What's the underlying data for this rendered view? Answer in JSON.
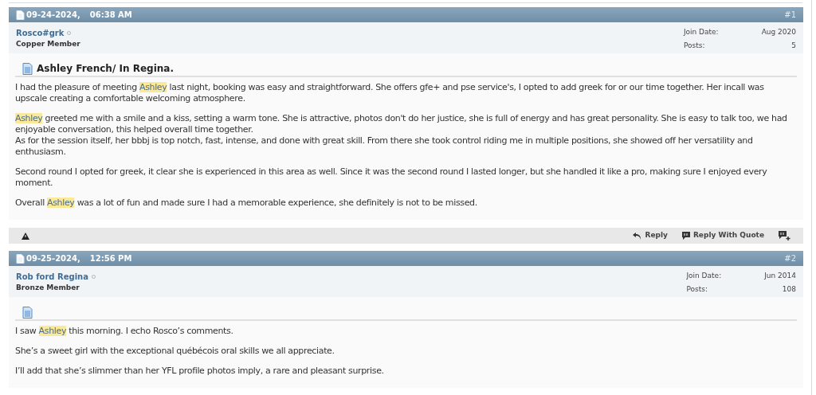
{
  "posts": [
    {
      "date": "09-24-2024,",
      "time": "06:38 AM",
      "number": "#1",
      "user": {
        "name": "Rosco#grk",
        "online": false,
        "rank": "Copper Member"
      },
      "stats": [
        {
          "label": "Join Date:",
          "value": "Aug 2020"
        },
        {
          "label": "Posts:",
          "value": "5"
        }
      ],
      "title": "Ashley French/ In Regina.",
      "paragraphs": [
        {
          "lines": [
            [
              {
                "text": "I had the pleasure of meeting ",
                "highlighted": false
              },
              {
                "text": "Ashley",
                "highlighted": true
              },
              {
                "text": " last night, booking was easy and straightforward. She offers gfe+ and pse service's, I opted to add greek for or our time together. Her incall was upscale creating a comfortable welcoming atmosphere.",
                "highlighted": false
              }
            ]
          ]
        },
        {
          "lines": [
            [
              {
                "text": "Ashley",
                "highlighted": true
              },
              {
                "text": " greeted me with a smile and a kiss, setting a warm tone. She is attractive, photos don't do her justice, she is full of energy and has great personality. She is easy to talk too, we had enjoyable conversation, this helped overall time together.",
                "highlighted": false
              }
            ],
            [
              {
                "text": "As for the session itself, her bbbj is top notch, fast, intense, and done with great skill. From there she took control riding me in multiple positions, she showed off her versatility and enthusiasm.",
                "highlighted": false
              }
            ]
          ]
        },
        {
          "lines": [
            [
              {
                "text": "Second round I opted for greek, it clear she is experienced in this area as well. Since it was the second round I lasted longer, but she handled it like a pro, making sure I enjoyed every moment.",
                "highlighted": false
              }
            ]
          ]
        },
        {
          "lines": [
            [
              {
                "text": "Overall ",
                "highlighted": false
              },
              {
                "text": "Ashley",
                "highlighted": true
              },
              {
                "text": " was a lot of fun and made sure I had a memorable experience, she definitely is not to be missed.",
                "highlighted": false
              }
            ]
          ]
        }
      ],
      "actions": [
        {
          "kind": "reply",
          "label": "Reply"
        },
        {
          "kind": "quote",
          "label": "Reply With Quote"
        },
        {
          "kind": "multiquote"
        }
      ]
    },
    {
      "date": "09-25-2024,",
      "time": "12:56 PM",
      "number": "#2",
      "user": {
        "name": "Rob ford Regina",
        "online": false,
        "rank": "Bronze Member"
      },
      "stats": [
        {
          "label": "Join Date:",
          "value": "Jun 2014"
        },
        {
          "label": "Posts:",
          "value": "108"
        }
      ],
      "paragraphs": [
        {
          "lines": [
            [
              {
                "text": "I saw ",
                "highlighted": false
              },
              {
                "text": "Ashley",
                "highlighted": true
              },
              {
                "text": " this morning. I echo Rosco’s comments.",
                "highlighted": false
              }
            ]
          ]
        },
        {
          "lines": [
            [
              {
                "text": "She’s a sweet girl with the exceptional québécois oral skills we all appreciate.",
                "highlighted": false
              }
            ]
          ]
        },
        {
          "lines": [
            [
              {
                "text": "I’ll add that she’s slimmer than her YFL profile photos imply, a rare and pleasant surprise.",
                "highlighted": false
              }
            ]
          ]
        }
      ]
    }
  ]
}
